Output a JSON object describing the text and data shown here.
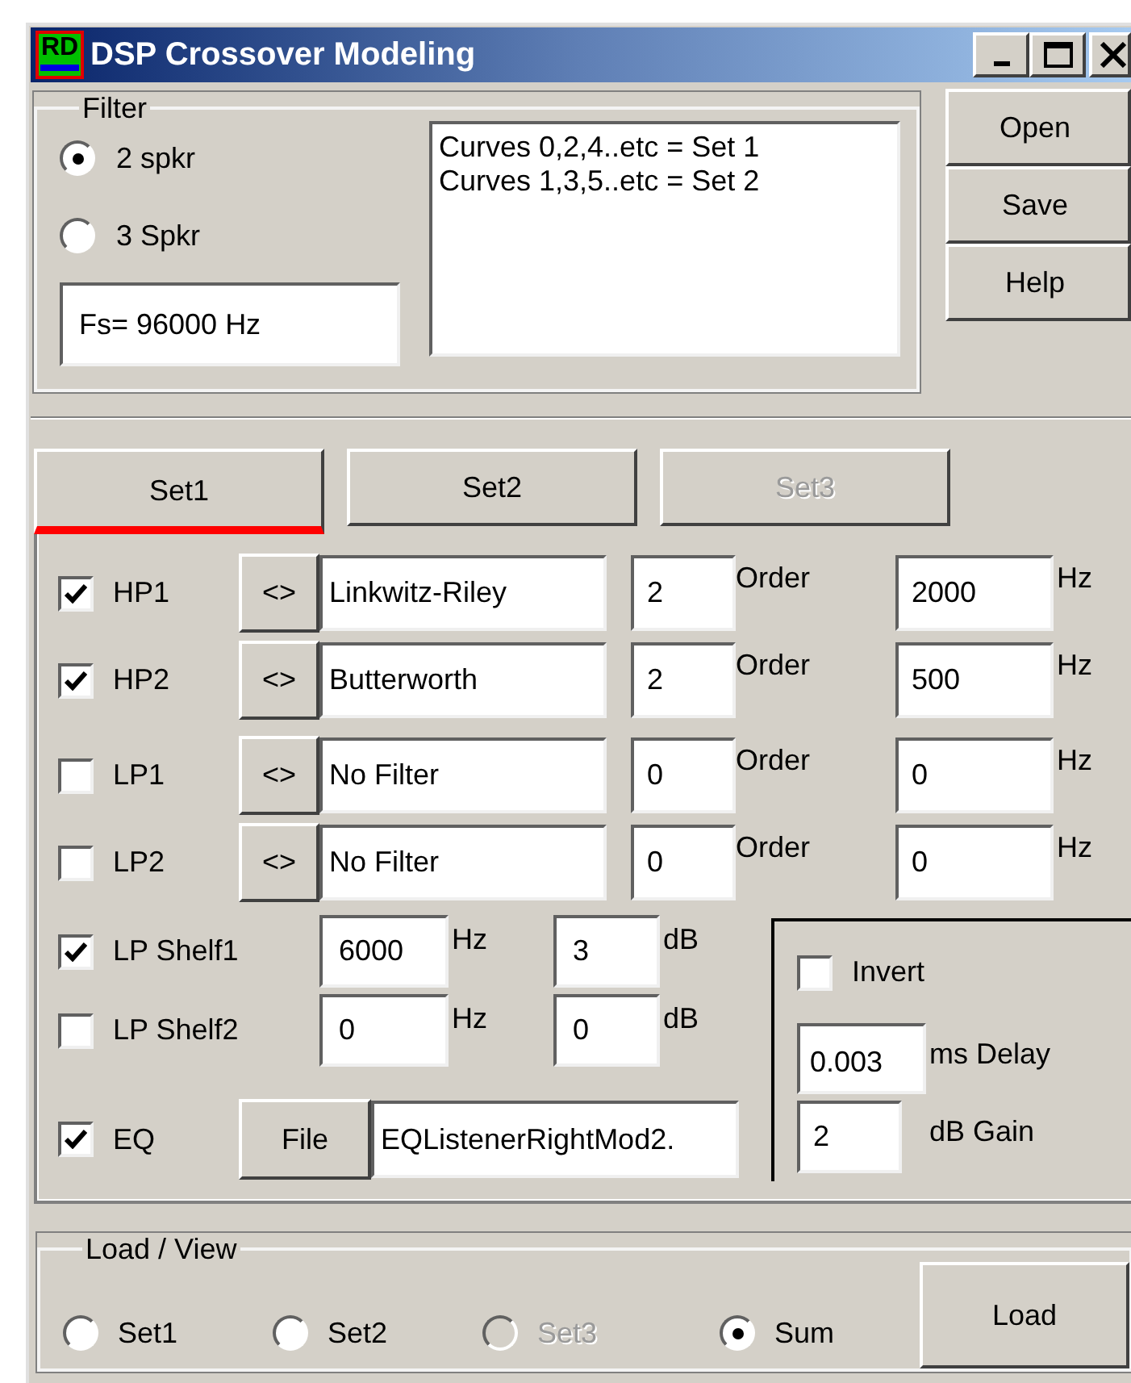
{
  "window": {
    "title": "DSP Crossover Modeling",
    "icon_text": "RD"
  },
  "filter": {
    "label": "Filter",
    "options": [
      {
        "label": "2 spkr",
        "selected": true
      },
      {
        "label": "3 Spkr",
        "selected": false
      }
    ],
    "sample_rate": "Fs= 96000 Hz",
    "notes": [
      "Curves 0,2,4..etc = Set 1",
      "Curves 1,3,5..etc = Set 2"
    ]
  },
  "side_buttons": [
    "Open",
    "Save",
    "Help"
  ],
  "tabs": [
    {
      "label": "Set1",
      "selected": true,
      "disabled": false
    },
    {
      "label": "Set2",
      "selected": false,
      "disabled": false
    },
    {
      "label": "Set3",
      "selected": false,
      "disabled": true
    }
  ],
  "filters": [
    {
      "label": "HP1",
      "checked": true,
      "toggle": "<>",
      "type": "Linkwitz-Riley",
      "order": "2",
      "order_unit": "Order",
      "freq": "2000",
      "freq_unit": "Hz"
    },
    {
      "label": "HP2",
      "checked": true,
      "toggle": "<>",
      "type": "Butterworth",
      "order": "2",
      "order_unit": "Order",
      "freq": "500",
      "freq_unit": "Hz"
    },
    {
      "label": "LP1",
      "checked": false,
      "toggle": "<>",
      "type": "No Filter",
      "order": "0",
      "order_unit": "Order",
      "freq": "0",
      "freq_unit": "Hz"
    },
    {
      "label": "LP2",
      "checked": false,
      "toggle": "<>",
      "type": "No Filter",
      "order": "0",
      "order_unit": "Order",
      "freq": "0",
      "freq_unit": "Hz"
    }
  ],
  "shelves": [
    {
      "label": "LP Shelf1",
      "checked": true,
      "freq": "6000",
      "freq_unit": "Hz",
      "gain": "3",
      "gain_unit": "dB"
    },
    {
      "label": "LP Shelf2",
      "checked": false,
      "freq": "0",
      "freq_unit": "Hz",
      "gain": "0",
      "gain_unit": "dB"
    }
  ],
  "eq": {
    "label": "EQ",
    "checked": true,
    "button": "File",
    "file": "EQListenerRightMod2."
  },
  "output": {
    "invert": {
      "label": "Invert",
      "checked": false
    },
    "delay": "0.003",
    "delay_unit": "ms Delay",
    "gain": "2",
    "gain_unit": "dB Gain"
  },
  "load_view": {
    "label": "Load / View",
    "options": [
      {
        "label": "Set1",
        "selected": false,
        "disabled": false
      },
      {
        "label": "Set2",
        "selected": false,
        "disabled": false
      },
      {
        "label": "Set3",
        "selected": false,
        "disabled": true
      },
      {
        "label": "Sum",
        "selected": true,
        "disabled": false
      }
    ],
    "button": "Load"
  }
}
